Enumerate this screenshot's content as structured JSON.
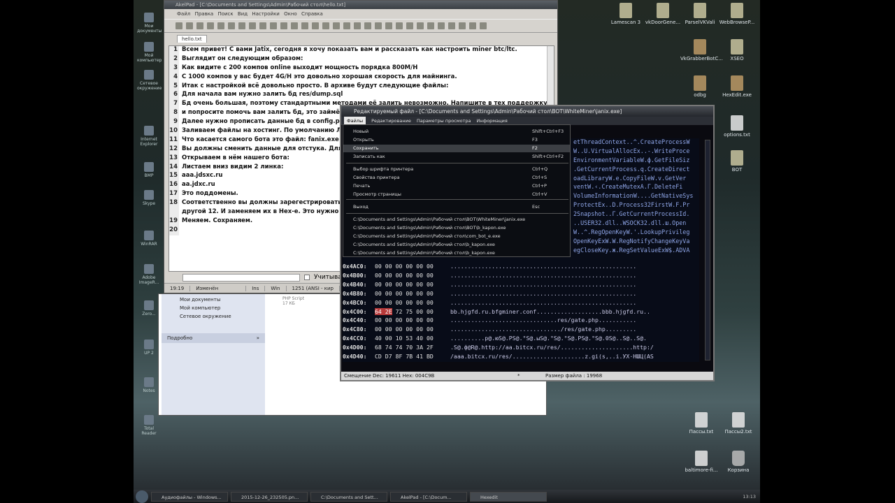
{
  "desktop_icons_right": [
    {
      "label": "Lamescan 3"
    },
    {
      "label": "vkDoorGene..."
    },
    {
      "label": "ParselVKVali"
    },
    {
      "label": "WebBrowseP..."
    },
    {
      "label": "VkGrabberBotC..."
    },
    {
      "label": "XSEO"
    },
    {
      "label": "odbg"
    },
    {
      "label": "HexEdit.exe"
    },
    {
      "label": "options.txt"
    },
    {
      "label": "BOT"
    },
    {
      "label": "Пассы.txt"
    },
    {
      "label": "Пассы2.txt"
    },
    {
      "label": "baltimore-fi..."
    },
    {
      "label": "Корзина"
    }
  ],
  "desktop_icons_left": [
    {
      "label": "Мои документы"
    },
    {
      "label": "Мой компьютер"
    },
    {
      "label": "Сетевое окружение"
    },
    {
      "label": "Internet Explorer"
    },
    {
      "label": "BMP"
    },
    {
      "label": "Skype"
    },
    {
      "label": "WinRAR"
    },
    {
      "label": "Adobe ImageR..."
    },
    {
      "label": "Zero..."
    },
    {
      "label": "UP 2"
    },
    {
      "label": "Notes"
    },
    {
      "label": "Total Reader"
    }
  ],
  "akelpad": {
    "title": "AkelPad - [C:\\Documents and Settings\\Admin\\Рабочий стол\\hello.txt]",
    "menu": [
      "Файл",
      "Правка",
      "Поиск",
      "Вид",
      "Настройки",
      "Окно",
      "Справка"
    ],
    "tab": "hello.txt",
    "lines": [
      {
        "n": "1",
        "text": "Всем привет! С вами Jatix, сегодня я хочу показать вам и рассказать как настроить miner btc/ltc."
      },
      {
        "n": "2",
        "text": "Выглядит он следующим образом:"
      },
      {
        "n": "3",
        "text": "Как видите с 200 компов online выходит мощность порядка 800M/H"
      },
      {
        "n": "4",
        "text": "С 1000 компов у вас будет 4G/H это довольно хорошая скорость для майнинга."
      },
      {
        "n": "5",
        "text": "Итак с настройкой всё довольно просто. В архиве будут следующие файлы:"
      },
      {
        "n": "6",
        "text": "Для начала вам нужно залить бд res/dump.sql"
      },
      {
        "n": "7",
        "text": "Бд очень большая, поэтому стандартными методами её залить невозможно. Напишите в тех поддержку"
      },
      {
        "n": "8",
        "text": "и попросите помочь вам залить бд, это займёт порядка"
      },
      {
        "n": "9",
        "text": "Далее нужно прописать данные бд в config.php"
      },
      {
        "n": "10",
        "text": "Заливаем файлы на хостинг. По умолчанию Логин: admin"
      },
      {
        "n": "11",
        "text": "Что касается самого бота это файл: fanix.exe"
      },
      {
        "n": "12",
        "text": "Вы должны сменить данные для отстука. Для этого"
      },
      {
        "n": "13",
        "text": "Открываем в нём нашего бота:"
      },
      {
        "n": "14",
        "text": "Листаем вниз видим 2 линка:"
      },
      {
        "n": "15",
        "text": "aaa.jdsxc.ru"
      },
      {
        "n": "16",
        "text": "aa.jdxc.ru"
      },
      {
        "n": "17",
        "text": "Это поддомены."
      },
      {
        "n": "18",
        "text": "Соответственно вы должны зарегестрировать домен"
      },
      {
        "n": "",
        "text": "другой 12. И заменяем их в Hex-е. Это нужно потом"
      },
      {
        "n": "19",
        "text": "Меняем. Сохраняем."
      },
      {
        "n": "20",
        "text": ""
      }
    ],
    "find_checkbox_label": "Учитывать регистр",
    "status": [
      "19:19",
      "Изменён",
      "Ins",
      "Win",
      "1251 (ANSI - кир"
    ]
  },
  "explorer": {
    "side_items": [
      "Мои документы",
      "Мой компьютер",
      "Сетевое окружение"
    ],
    "section": "Подробно",
    "file_name": "PHP Script",
    "file_size": "17 КБ"
  },
  "hexedit": {
    "title": "Редактируемый файл - [C:\\Documents and Settings\\Admin\\Рабочий стол\\BOT\\WhiteMiner\\janix.exe]",
    "menu": [
      "Файлы",
      "Редактирование",
      "Параметры просмотра",
      "Информация"
    ],
    "file_menu": [
      {
        "label": "Новый",
        "key": "Shift+Ctrl+F3"
      },
      {
        "label": "Открыть",
        "key": "F3"
      },
      {
        "label": "Сохранить",
        "key": "F2",
        "selected": true
      },
      {
        "label": "Записать как",
        "key": "Shift+Ctrl+F2"
      },
      {
        "label": "Выбор шрифта принтера",
        "key": "Ctrl+Q"
      },
      {
        "label": "Свойства принтера",
        "key": "Ctrl+S"
      },
      {
        "label": "Печать",
        "key": "Ctrl+P"
      },
      {
        "label": "Просмотр страницы",
        "key": "Ctrl+V"
      },
      {
        "label": "Выход",
        "key": "Esc"
      }
    ],
    "recent_files": [
      "C:\\Documents and Settings\\Admin\\Рабочий стол\\BOT\\WhiteMiner\\janix.exe",
      "C:\\Documents and Settings\\Admin\\Рабочий стол\\BOT\\b_kapon.exe",
      "C:\\Documents and Settings\\Admin\\Рабочий стол\\com_bot_e.exe",
      "C:\\Documents and Settings\\Admin\\Рабочий стол\\b_kapon.exe",
      "C:\\Documents and Settings\\Admin\\Рабочий стол\\b_kapon.exe"
    ],
    "ascii_top": [
      "etThreadContext..^.CreateProcessW",
      "W..U.VirtualAllocEx..-.WriteProce",
      "EnvironmentVariableW.ф.GetFileSiz",
      ".GetCurrentProcess.q.CreateDirect",
      "oadLibraryW.е.CopyFileW.v.GetVer",
      "ventW.‹.CreateMutexA.Г.DeleteFi",
      "VolumeInformationW....GetNativeSys",
      "ProtectEx..D.Process32FirstW.F.Pr",
      "2Snapshot..Г.GetCurrentProcessId.",
      "..USER32.dll..WSOCK32.dll.ш.Open",
      "W..^.RegOpenKeyW.'.LookupPrivileg",
      "OpenKeyExW.W.RegNotifyChangeKeyVa",
      "egCloseKey.ж.RegSetValueExW$.ADVA"
    ],
    "rows": [
      {
        "off": "0x4AC0:",
        "bytes": "00 00 00 00 00 00",
        "asc": "......................................................"
      },
      {
        "off": "0x4B00:",
        "bytes": "00 00 00 00 00 00",
        "asc": "......................................................"
      },
      {
        "off": "0x4B40:",
        "bytes": "00 00 00 00 00 00",
        "asc": "......................................................"
      },
      {
        "off": "0x4B80:",
        "bytes": "00 00 00 00 00 00",
        "asc": "......................................................"
      },
      {
        "off": "0x4BC0:",
        "bytes": "00 00 00 00 00 00",
        "asc": "......................................................"
      },
      {
        "off": "0x4C00:",
        "bytes": "64 2E 72 75 00 00",
        "asc": "bb.hjgfd.ru.bfgminer.conf...................bbb.hjgfd.ru.."
      },
      {
        "off": "0x4C40:",
        "bytes": "00 00 00 00 00 00",
        "asc": "...............................res/gate.php..........."
      },
      {
        "off": "0x4C80:",
        "bytes": "00 00 00 00 00 00",
        "asc": "................................/res/gate.php........."
      },
      {
        "off": "0x4CC0:",
        "bytes": "40 00 10 53 40 00",
        "asc": "..........p@.юS@.PS@.°S@.ыS@.°S@.°S@.PS@.°S@.0S@..S@..S@."
      },
      {
        "off": "0x4D00:",
        "bytes": "68 74 74 70 3A 2F",
        "asc": ".S@.ф@R@.http://aa.bitcx.ru/res/.....................http:/"
      },
      {
        "off": "0x4D40:",
        "bytes": "CD D7 8F 7B 41 BD",
        "asc": "/aaa.bitcx.ru/res/.....................z.gi(s,..i.УХ·НШЦ(АS"
      }
    ],
    "status_offset": "Смещение Dec: 19611 Hex: 004C9B",
    "status_mark": "*",
    "status_size": "Размер файла : 19968"
  },
  "taskbar": {
    "tasks": [
      "Аудиофайлы - Windows...",
      "2015-12-26_232505.pn...",
      "C:\\Documents and Sett...",
      "AkelPad - [C:\\Docum...",
      "Hexedit"
    ],
    "active_index": 4,
    "clock": "13:13"
  }
}
